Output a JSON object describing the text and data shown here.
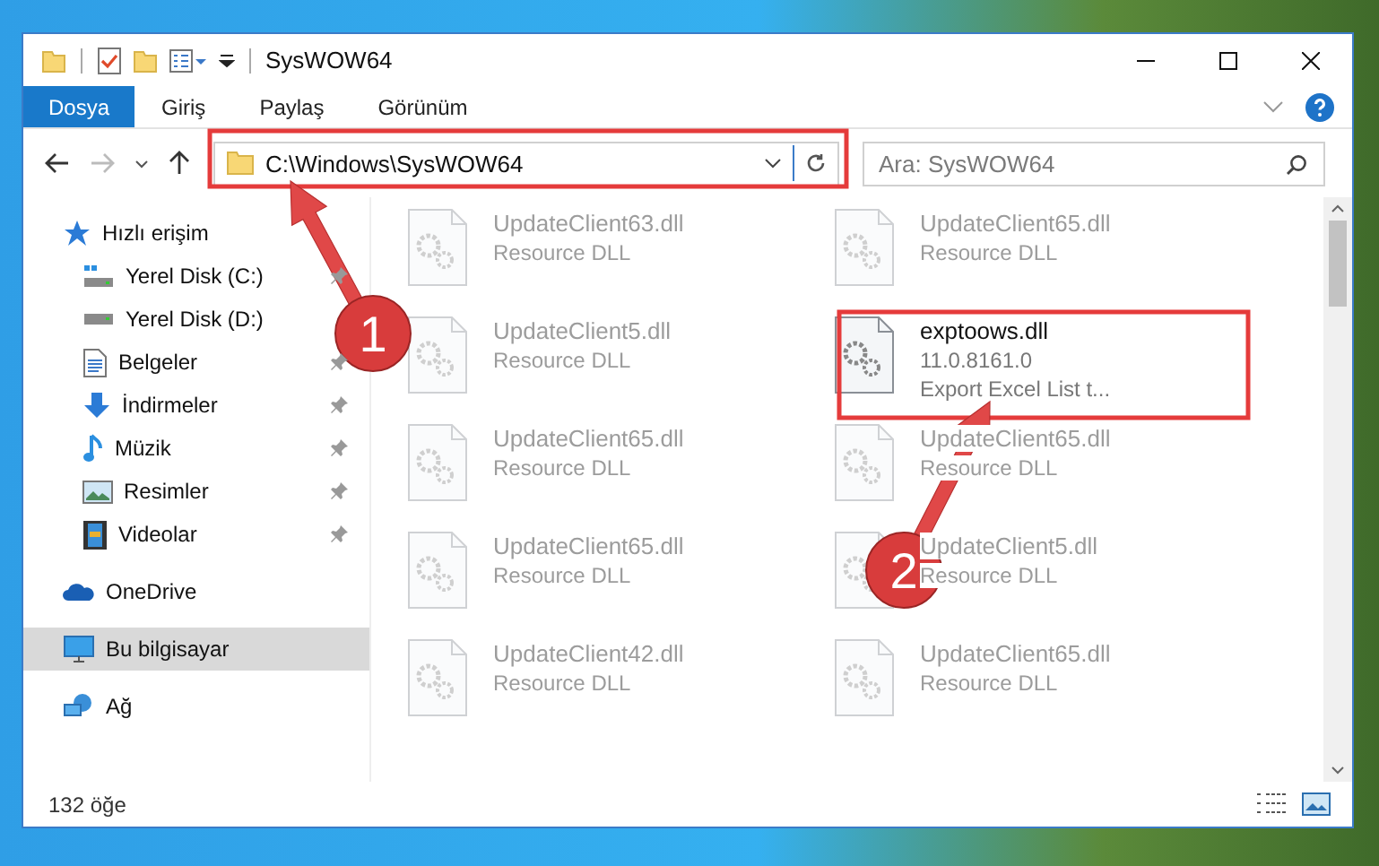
{
  "window": {
    "title": "SysWOW64"
  },
  "ribbon_tabs": [
    {
      "label": "Dosya",
      "selected": true
    },
    {
      "label": "Giriş",
      "selected": false
    },
    {
      "label": "Paylaş",
      "selected": false
    },
    {
      "label": "Görünüm",
      "selected": false
    }
  ],
  "address_bar": {
    "path": "C:\\Windows\\SysWOW64"
  },
  "search": {
    "placeholder": "Ara: SysWOW64"
  },
  "sidebar": {
    "items": [
      {
        "label": "Hızlı erişim",
        "kind": "star",
        "selected": false,
        "children": [
          {
            "label": "Yerel Disk (C:)",
            "kind": "system-drive",
            "pinned": true,
            "selected": false
          },
          {
            "label": "Yerel Disk (D:)",
            "kind": "drive",
            "pinned": false,
            "selected": false
          },
          {
            "label": "Belgeler",
            "kind": "document",
            "pinned": true,
            "selected": false
          },
          {
            "label": "İndirmeler",
            "kind": "download",
            "pinned": true,
            "selected": false
          },
          {
            "label": "Müzik",
            "kind": "music",
            "pinned": true,
            "selected": false
          },
          {
            "label": "Resimler",
            "kind": "picture",
            "pinned": true,
            "selected": false
          },
          {
            "label": "Videolar",
            "kind": "video",
            "pinned": true,
            "selected": false
          }
        ]
      },
      {
        "label": "OneDrive",
        "kind": "cloud",
        "selected": false
      },
      {
        "label": "Bu bilgisayar",
        "kind": "computer",
        "selected": true
      },
      {
        "label": "Ağ",
        "kind": "network",
        "selected": false
      }
    ]
  },
  "files": [
    {
      "name": "UpdateClient63.dll",
      "detail": "Resource DLL",
      "dimmed": true
    },
    {
      "name": "UpdateClient65.dll",
      "detail": "Resource DLL",
      "dimmed": true
    },
    {
      "name": "UpdateClient5.dll",
      "detail": "Resource DLL",
      "dimmed": true
    },
    {
      "name": "exptoows.dll",
      "version": "11.0.8161.0",
      "detail": "Export Excel List t...",
      "dimmed": false
    },
    {
      "name": "UpdateClient65.dll",
      "detail": "Resource DLL",
      "dimmed": true
    },
    {
      "name": "UpdateClient65.dll",
      "detail": "Resource DLL",
      "dimmed": true
    },
    {
      "name": "UpdateClient65.dll",
      "detail": "Resource DLL",
      "dimmed": true
    },
    {
      "name": "UpdateClient5.dll",
      "detail": "Resource DLL",
      "dimmed": true
    },
    {
      "name": "UpdateClient42.dll",
      "detail": "Resource DLL",
      "dimmed": true
    },
    {
      "name": "UpdateClient65.dll",
      "detail": "Resource DLL",
      "dimmed": true
    }
  ],
  "status_bar": {
    "item_count": "132 öğe"
  },
  "annotations": [
    {
      "number": "1"
    },
    {
      "number": "2"
    }
  ]
}
